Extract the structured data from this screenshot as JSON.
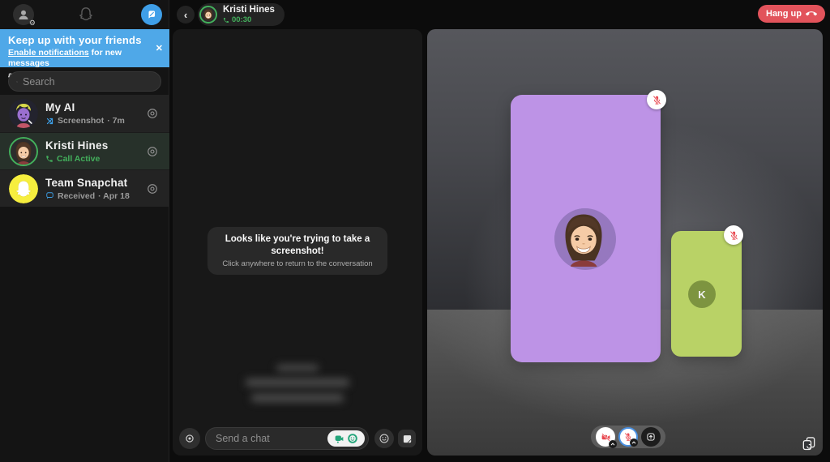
{
  "colors": {
    "accent_blue": "#4FA8E8",
    "call_green": "#43B05C",
    "mute_red": "#E8474F",
    "hangup_red": "#E2535B",
    "purple_card": "#BD93E6",
    "green_card": "#B9D266",
    "snapchat_yellow": "#F6EE3E"
  },
  "sidebar": {
    "banner": {
      "title": "Keep up with your friends",
      "link_text": "Enable notifications",
      "link_suffix": " for new messages",
      "second_line": "and incoming calls",
      "close_label": "✕"
    },
    "search": {
      "placeholder": "Search"
    },
    "chats": [
      {
        "name": "My AI",
        "status": "Screenshot",
        "meta": "· 7m"
      },
      {
        "name": "Kristi Hines",
        "status": "Call Active",
        "meta": ""
      },
      {
        "name": "Team Snapchat",
        "status": "Received",
        "meta": "· Apr 18"
      }
    ]
  },
  "header": {
    "contact_name": "Kristi Hines",
    "call_timer": "00:30",
    "hang_up_label": "Hang up"
  },
  "chat": {
    "toast_title": "Looks like you're trying to take a screenshot!",
    "toast_subtitle": "Click anywhere to return to the conversation",
    "input_placeholder": "Send a chat"
  },
  "call": {
    "participant_initial": "K"
  }
}
